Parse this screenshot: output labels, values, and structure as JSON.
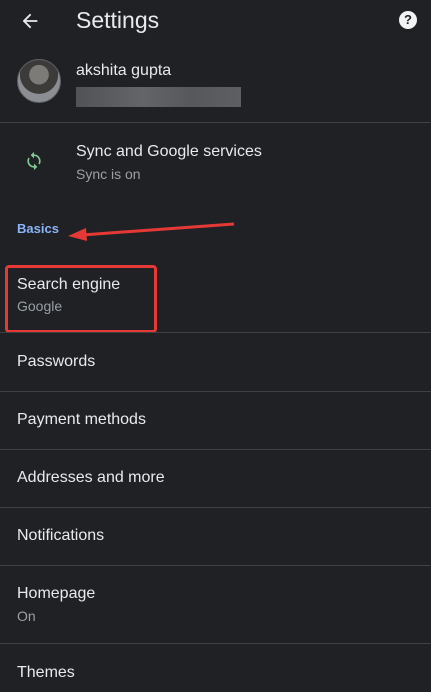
{
  "header": {
    "title": "Settings",
    "help_label": "?"
  },
  "profile": {
    "name": "akshita gupta"
  },
  "sync": {
    "title": "Sync and Google services",
    "subtitle": "Sync is on"
  },
  "section": {
    "label": "Basics"
  },
  "items": [
    {
      "title": "Search engine",
      "subtitle": "Google"
    },
    {
      "title": "Passwords"
    },
    {
      "title": "Payment methods"
    },
    {
      "title": "Addresses and more"
    },
    {
      "title": "Notifications"
    },
    {
      "title": "Homepage",
      "subtitle": "On"
    },
    {
      "title": "Themes"
    }
  ],
  "icons": {
    "back": "arrow-back-icon",
    "help": "help-icon",
    "sync": "sync-icon",
    "annotation": "red-arrow-annotation"
  },
  "colors": {
    "background": "#202124",
    "accent": "#8ab4f8",
    "sync_green": "#81c995",
    "annotation_red": "#e53935"
  }
}
